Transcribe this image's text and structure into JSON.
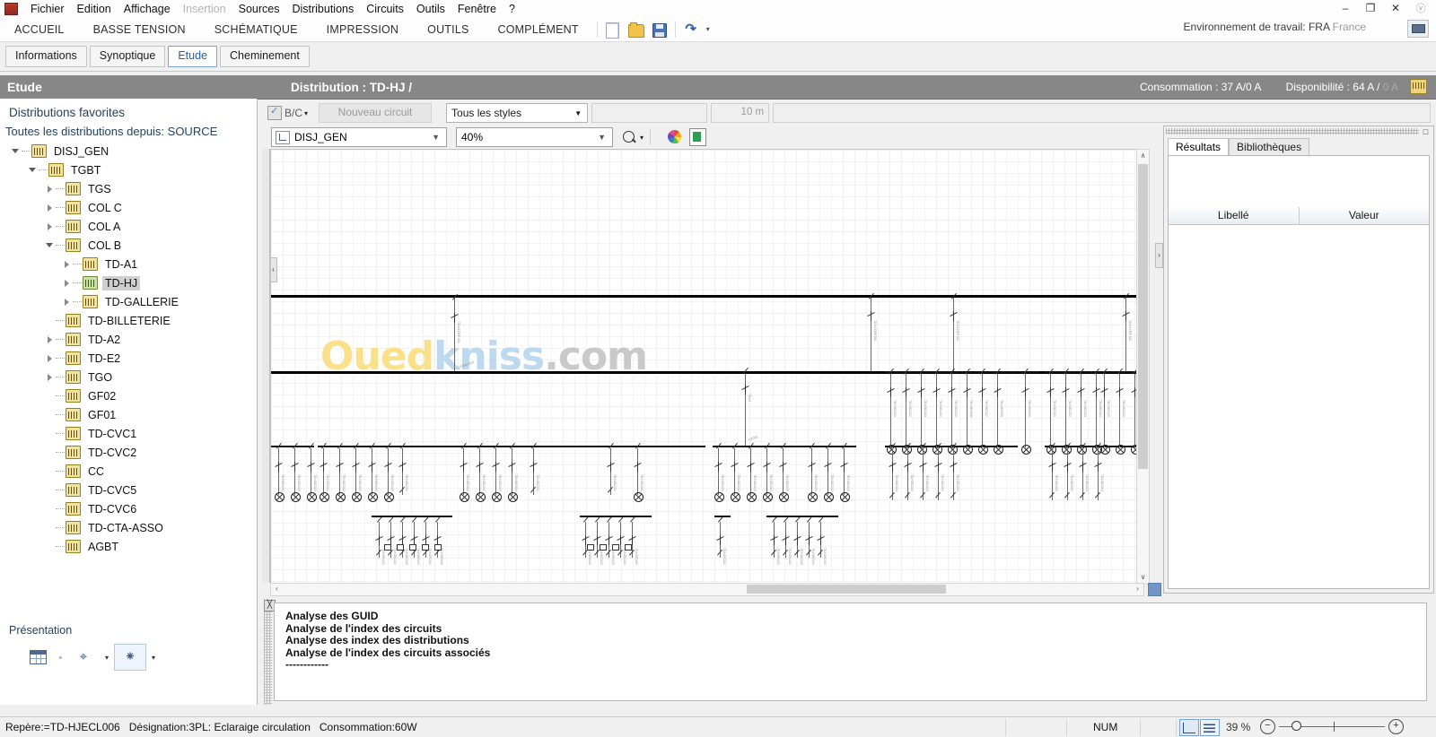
{
  "menubar": {
    "items": [
      {
        "label": "Fichier",
        "disabled": false
      },
      {
        "label": "Edition",
        "disabled": false
      },
      {
        "label": "Affichage",
        "disabled": false
      },
      {
        "label": "Insertion",
        "disabled": true
      },
      {
        "label": "Sources",
        "disabled": false
      },
      {
        "label": "Distributions",
        "disabled": false
      },
      {
        "label": "Circuits",
        "disabled": false
      },
      {
        "label": "Outils",
        "disabled": false
      },
      {
        "label": "Fenêtre",
        "disabled": false
      },
      {
        "label": "?",
        "disabled": false
      }
    ],
    "window_controls": {
      "minimize": "–",
      "restore": "❐",
      "close": "✕",
      "help": "ⓥ"
    }
  },
  "ribbon": {
    "tabs": [
      "ACCUEIL",
      "BASSE TENSION",
      "SCHÉMATIQUE",
      "IMPRESSION",
      "OUTILS",
      "COMPLÉMENT"
    ],
    "quick_access": [
      "new-document-icon",
      "open-folder-icon",
      "save-icon",
      "undo-icon",
      "overflow-caret-icon"
    ],
    "environment_label": "Environnement de travail: FRA",
    "environment_country": "France"
  },
  "subtabs": {
    "items": [
      "Informations",
      "Synoptique",
      "Etude",
      "Cheminement"
    ],
    "active": "Etude"
  },
  "header": {
    "left_title": "Etude",
    "distribution": "Distribution : TD-HJ /",
    "consumption": "Consommation : 37 A/0 A",
    "availability": "Disponibilité : 64 A /",
    "availability_dim": "0 A"
  },
  "sidebar": {
    "favorites_title": "Distributions favorites",
    "all_distributions": "Toutes les distributions depuis: SOURCE",
    "tree": [
      {
        "label": "DISJ_GEN",
        "depth": 0,
        "state": "open",
        "selected": false
      },
      {
        "label": "TGBT",
        "depth": 1,
        "state": "open",
        "selected": false
      },
      {
        "label": "TGS",
        "depth": 2,
        "state": "closed",
        "selected": false
      },
      {
        "label": "COL C",
        "depth": 2,
        "state": "closed",
        "selected": false
      },
      {
        "label": "COL A",
        "depth": 2,
        "state": "closed",
        "selected": false
      },
      {
        "label": "COL B",
        "depth": 2,
        "state": "open",
        "selected": false
      },
      {
        "label": "TD-A1",
        "depth": 3,
        "state": "closed",
        "selected": false
      },
      {
        "label": "TD-HJ",
        "depth": 3,
        "state": "closed",
        "selected": true
      },
      {
        "label": "TD-GALLERIE",
        "depth": 3,
        "state": "closed",
        "selected": false
      },
      {
        "label": "TD-BILLETERIE",
        "depth": 2,
        "state": "leaf",
        "selected": false
      },
      {
        "label": "TD-A2",
        "depth": 2,
        "state": "closed",
        "selected": false
      },
      {
        "label": "TD-E2",
        "depth": 2,
        "state": "closed",
        "selected": false
      },
      {
        "label": "TGO",
        "depth": 2,
        "state": "closed",
        "selected": false
      },
      {
        "label": "GF02",
        "depth": 2,
        "state": "leaf",
        "selected": false
      },
      {
        "label": "GF01",
        "depth": 2,
        "state": "leaf",
        "selected": false
      },
      {
        "label": "TD-CVC1",
        "depth": 2,
        "state": "leaf",
        "selected": false
      },
      {
        "label": "TD-CVC2",
        "depth": 2,
        "state": "leaf",
        "selected": false
      },
      {
        "label": "CC",
        "depth": 2,
        "state": "leaf",
        "selected": false
      },
      {
        "label": "TD-CVC5",
        "depth": 2,
        "state": "leaf",
        "selected": false
      },
      {
        "label": "TD-CVC6",
        "depth": 2,
        "state": "leaf",
        "selected": false
      },
      {
        "label": "TD-CTA-ASSO",
        "depth": 2,
        "state": "leaf",
        "selected": false
      },
      {
        "label": "AGBT",
        "depth": 2,
        "state": "leaf",
        "selected": false
      }
    ],
    "presentation_title": "Présentation",
    "presentation_buttons": [
      "table-view-icon",
      "tree-layout-icon",
      "align-layout-icon"
    ]
  },
  "toolbar": {
    "bc_label": "B/C",
    "new_circuit_label": "Nouveau circuit",
    "style_select_value": "Tous les styles",
    "text_field_value": "",
    "length_field_value": "10 m",
    "wide_field_value": "",
    "distribution_select_value": "DISJ_GEN",
    "zoom_select_value": "40%",
    "icons": [
      "magnifier-icon",
      "caret-down-icon",
      "palette-icon",
      "export-excel-icon"
    ]
  },
  "right_panel": {
    "tabs": [
      "Résultats",
      "Bibliothèques"
    ],
    "active_tab": "Résultats",
    "columns": [
      "Libellé",
      "Valeur"
    ],
    "rows": []
  },
  "log_panel": {
    "lines": [
      "Analyse des GUID",
      "Analyse de l'index des circuits",
      "Analyse des index des distributions",
      "Analyse de l'index des circuits associés",
      "------------"
    ]
  },
  "statusbar": {
    "repere": "Repère:=TD-HJECL006",
    "designation": "Désignation:3PL: Eclaraige circulation",
    "consumption": "Consommation:60W",
    "num_indicator": "NUM",
    "zoom_percent": "39 %",
    "zoom_minus": "−",
    "zoom_plus": "+"
  },
  "canvas": {
    "watermark": {
      "part1": "Oued",
      "part2": "kniss",
      "part3": ".com"
    },
    "scrollbars": {
      "up": "∧",
      "down": "∨",
      "left": "‹",
      "right": "›"
    }
  }
}
